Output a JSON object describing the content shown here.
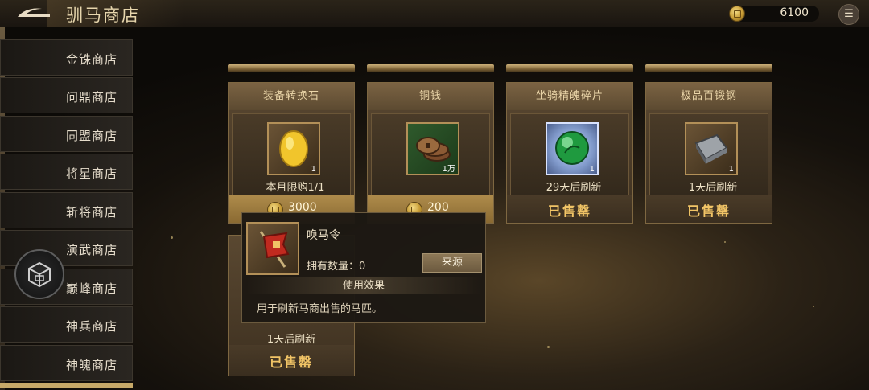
{
  "header": {
    "title": "驯马商店",
    "currency_value": "6100"
  },
  "sidebar": {
    "items": [
      {
        "label": "金铢商店"
      },
      {
        "label": "问鼎商店"
      },
      {
        "label": "同盟商店"
      },
      {
        "label": "将星商店"
      },
      {
        "label": "斩将商店"
      },
      {
        "label": "演武商店"
      },
      {
        "label": "巅峰商店"
      },
      {
        "label": "神兵商店"
      },
      {
        "label": "神魄商店"
      }
    ]
  },
  "cards": [
    {
      "title": "装备转换石",
      "qty": "1",
      "caption": "本月限购1/1",
      "price": "3000",
      "sold": ""
    },
    {
      "title": "铜钱",
      "qty": "1万",
      "caption": "",
      "price": "200",
      "sold": ""
    },
    {
      "title": "坐骑精魄碎片",
      "qty": "1",
      "caption": "29天后刷新",
      "price": "",
      "sold": "已售罄"
    },
    {
      "title": "极品百锻钢",
      "qty": "1",
      "caption": "1天后刷新",
      "price": "",
      "sold": "已售罄"
    },
    {
      "title": "",
      "qty": "",
      "caption": "1天后刷新",
      "price": "",
      "sold": "已售罄"
    }
  ],
  "tooltip": {
    "name": "唤马令",
    "own_label": "拥有数量：0",
    "source_button": "来源",
    "effect_title": "使用效果",
    "description": "用于刷新马商出售的马匹。"
  },
  "icons": {
    "back": "back-arrow-icon",
    "currency": "gold-coin-icon",
    "menu": "list-menu-icon",
    "float": "treasure-chest-icon"
  },
  "colors": {
    "sold_text": "#f1c466",
    "price_bar": "#ae8b4b"
  }
}
